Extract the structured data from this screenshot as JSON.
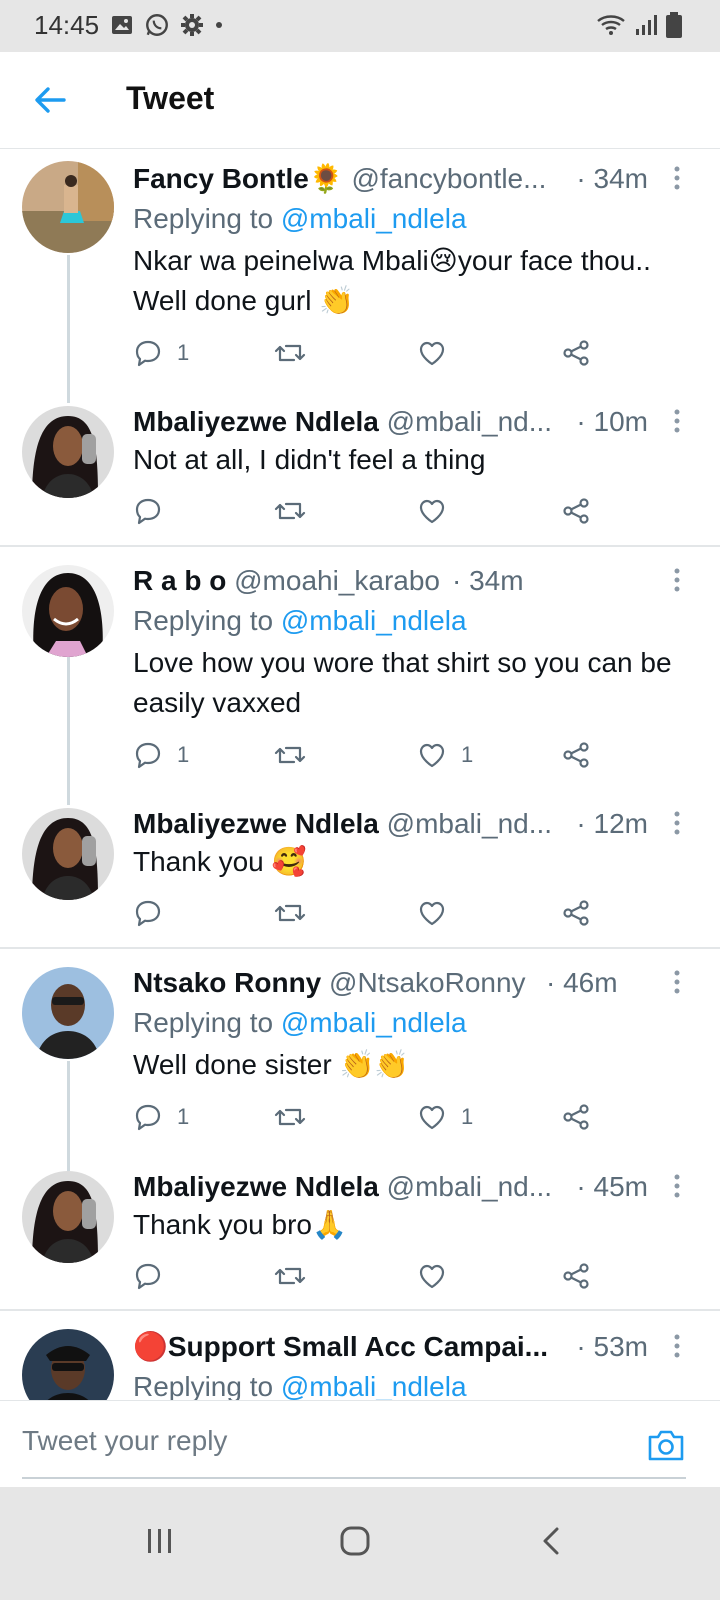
{
  "status": {
    "time": "14:45"
  },
  "header": {
    "title": "Tweet"
  },
  "tweets": [
    {
      "name": "Fancy Bontle",
      "name_emoji": "🌻",
      "handle": "@fancybontle...",
      "time": "· 34m",
      "replying_prefix": "Replying to ",
      "replying_to": "@mbali_ndlela",
      "text": "Nkar wa peinelwa Mbali😢your face thou.. Well done gurl 👏",
      "reply_count": "1",
      "like_count": ""
    },
    {
      "name": "Mbaliyezwe Ndlela",
      "handle": "@mbali_nd...",
      "time": "· 10m",
      "text": "Not at all, I didn't feel a thing",
      "reply_count": "",
      "like_count": ""
    },
    {
      "name": "R a b o",
      "handle": "@moahi_karabo",
      "time": "· 34m",
      "replying_prefix": "Replying to ",
      "replying_to": "@mbali_ndlela",
      "text": "Love how you wore that shirt so you can be easily vaxxed",
      "reply_count": "1",
      "like_count": "1"
    },
    {
      "name": "Mbaliyezwe Ndlela",
      "handle": "@mbali_nd...",
      "time": "· 12m",
      "text": "Thank you 🥰",
      "reply_count": "",
      "like_count": ""
    },
    {
      "name": "Ntsako Ronny",
      "handle": "@NtsakoRonny",
      "time": "· 46m",
      "replying_prefix": "Replying to ",
      "replying_to": "@mbali_ndlela",
      "text": "Well done sister 👏👏",
      "reply_count": "1",
      "like_count": "1"
    },
    {
      "name": "Mbaliyezwe Ndlela",
      "handle": "@mbali_nd...",
      "time": "· 45m",
      "text": "Thank you bro🙏",
      "reply_count": "",
      "like_count": ""
    },
    {
      "name": "🔴Support Small Acc Campai...",
      "handle": "",
      "time": "· 53m",
      "replying_prefix": "Replying to ",
      "replying_to": "@mbali_ndlela"
    }
  ],
  "composer": {
    "placeholder": "Tweet your reply"
  },
  "colors": {
    "accent": "#1d9bf0",
    "muted": "#5b6b78"
  }
}
